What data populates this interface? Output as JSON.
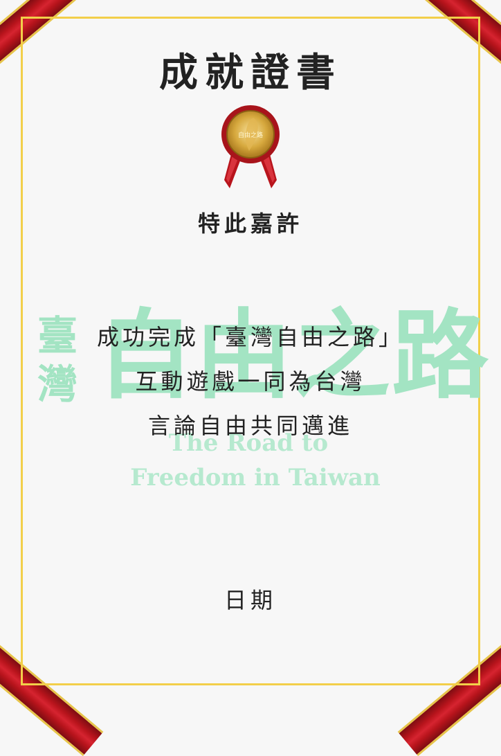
{
  "title": "成就證書",
  "medal": {
    "text": "自由之路",
    "icon": "gold-medal-icon"
  },
  "commendation": "特此嘉許",
  "watermark": {
    "side": [
      "臺",
      "灣"
    ],
    "main": "自由之路",
    "english_line1": "The Road to",
    "english_line2": "Freedom in Taiwan"
  },
  "body": {
    "line1": "成功完成「臺灣自由之路」",
    "line2": "互動遊戲一同為台灣",
    "line3": "言論自由共同邁進"
  },
  "date_label": "日期",
  "colors": {
    "ribbon": "#b8141c",
    "border": "#f2cf4a",
    "watermark": "#a3e4c3",
    "text": "#222222"
  }
}
